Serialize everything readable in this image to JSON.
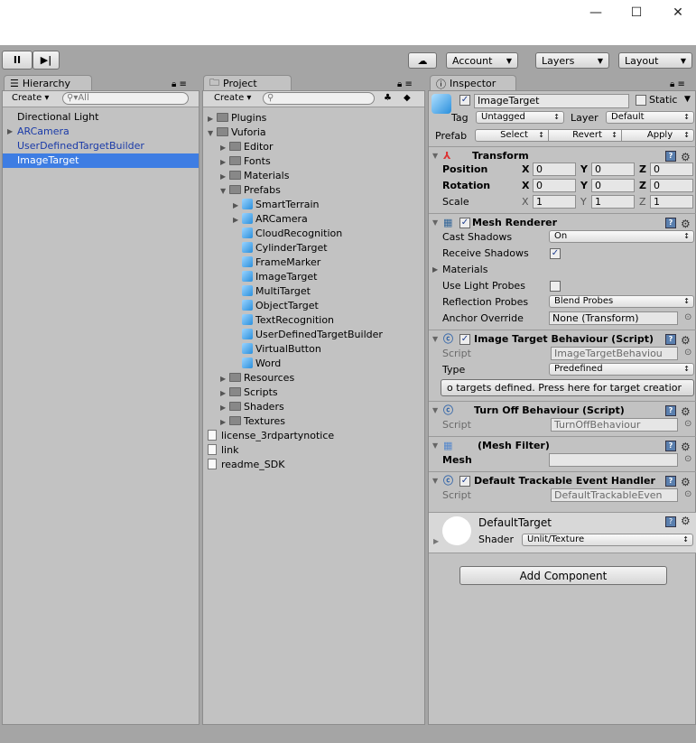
{
  "window": {
    "minimize": "—",
    "maximize": "☐",
    "close": "✕"
  },
  "toolbar": {
    "pause": "II",
    "step": "▶|",
    "account": "Account",
    "layers": "Layers",
    "layout": "Layout"
  },
  "hierarchy": {
    "tab": "Hierarchy",
    "create": "Create",
    "search_placeholder": "All",
    "items": [
      {
        "label": "Directional Light",
        "color": "#000000"
      },
      {
        "label": "ARCamera",
        "color": "#1a3aa8"
      },
      {
        "label": "UserDefinedTargetBuilder",
        "color": "#1a3aa8"
      },
      {
        "label": "ImageTarget",
        "selected": true
      }
    ]
  },
  "project": {
    "tab": "Project",
    "create": "Create",
    "tree": [
      {
        "label": "Plugins",
        "type": "folder",
        "depth": 0,
        "arrow": "right"
      },
      {
        "label": "Vuforia",
        "type": "folder",
        "depth": 0,
        "arrow": "down"
      },
      {
        "label": "Editor",
        "type": "folder",
        "depth": 1,
        "arrow": "right"
      },
      {
        "label": "Fonts",
        "type": "folder",
        "depth": 1,
        "arrow": "right"
      },
      {
        "label": "Materials",
        "type": "folder",
        "depth": 1,
        "arrow": "right"
      },
      {
        "label": "Prefabs",
        "type": "folder",
        "depth": 1,
        "arrow": "down"
      },
      {
        "label": "SmartTerrain",
        "type": "prefab",
        "depth": 2,
        "arrow": "right"
      },
      {
        "label": "ARCamera",
        "type": "prefab",
        "depth": 2,
        "arrow": "right"
      },
      {
        "label": "CloudRecognition",
        "type": "prefab",
        "depth": 2
      },
      {
        "label": "CylinderTarget",
        "type": "prefab",
        "depth": 2
      },
      {
        "label": "FrameMarker",
        "type": "prefab",
        "depth": 2
      },
      {
        "label": "ImageTarget",
        "type": "prefab",
        "depth": 2
      },
      {
        "label": "MultiTarget",
        "type": "prefab",
        "depth": 2
      },
      {
        "label": "ObjectTarget",
        "type": "prefab",
        "depth": 2
      },
      {
        "label": "TextRecognition",
        "type": "prefab",
        "depth": 2
      },
      {
        "label": "UserDefinedTargetBuilder",
        "type": "prefab",
        "depth": 2
      },
      {
        "label": "VirtualButton",
        "type": "prefab",
        "depth": 2
      },
      {
        "label": "Word",
        "type": "prefab",
        "depth": 2
      },
      {
        "label": "Resources",
        "type": "folder",
        "depth": 1,
        "arrow": "right"
      },
      {
        "label": "Scripts",
        "type": "folder",
        "depth": 1,
        "arrow": "right"
      },
      {
        "label": "Shaders",
        "type": "folder",
        "depth": 1,
        "arrow": "right"
      },
      {
        "label": "Textures",
        "type": "folder",
        "depth": 1,
        "arrow": "right"
      },
      {
        "label": "license_3rdpartynotice",
        "type": "file",
        "depth": 0
      },
      {
        "label": "link",
        "type": "file",
        "depth": 0
      },
      {
        "label": "readme_SDK",
        "type": "file",
        "depth": 0
      }
    ]
  },
  "inspector": {
    "tab": "Inspector",
    "name": "ImageTarget",
    "static": "Static",
    "tag_label": "Tag",
    "tag": "Untagged",
    "layer_label": "Layer",
    "layer": "Default",
    "prefab_label": "Prefab",
    "select": "Select",
    "revert": "Revert",
    "apply": "Apply",
    "transform": {
      "title": "Transform",
      "position": "Position",
      "rotation": "Rotation",
      "scale": "Scale",
      "x": "X",
      "y": "Y",
      "z": "Z",
      "pos": [
        "0",
        "0",
        "0"
      ],
      "rot": [
        "0",
        "0",
        "0"
      ],
      "scl": [
        "1",
        "1",
        "1"
      ]
    },
    "mesh_renderer": {
      "title": "Mesh Renderer",
      "cast_shadows": "Cast Shadows",
      "cast_value": "On",
      "receive_shadows": "Receive Shadows",
      "materials": "Materials",
      "light_probes": "Use Light Probes",
      "reflection_probes": "Reflection Probes",
      "reflection_value": "Blend Probes",
      "anchor_override": "Anchor Override",
      "anchor_value": "None (Transform)"
    },
    "itb": {
      "title": "Image Target Behaviour (Script)",
      "script_label": "Script",
      "script": "ImageTargetBehaviou",
      "type_label": "Type",
      "type": "Predefined",
      "button": "o targets defined. Press here for target creatior"
    },
    "turnoff": {
      "title": "Turn Off Behaviour (Script)",
      "script_label": "Script",
      "script": "TurnOffBehaviour"
    },
    "meshfilter": {
      "title": "(Mesh Filter)",
      "mesh_label": "Mesh"
    },
    "dteh": {
      "title": "Default Trackable Event Handler",
      "script_label": "Script",
      "script": "DefaultTrackableEven"
    },
    "material": {
      "name": "DefaultTarget",
      "shader_label": "Shader",
      "shader": "Unlit/Texture"
    },
    "add_component": "Add Component"
  }
}
